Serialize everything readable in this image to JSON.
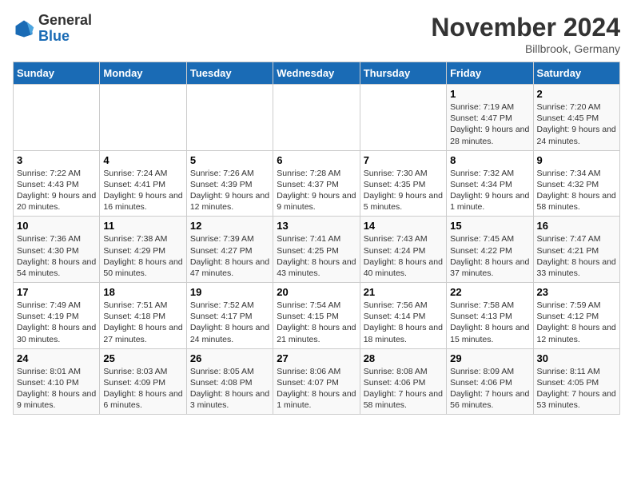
{
  "header": {
    "month_title": "November 2024",
    "location": "Billbrook, Germany",
    "logo_general": "General",
    "logo_blue": "Blue"
  },
  "days_of_week": [
    "Sunday",
    "Monday",
    "Tuesday",
    "Wednesday",
    "Thursday",
    "Friday",
    "Saturday"
  ],
  "weeks": [
    [
      {
        "day": "",
        "info": ""
      },
      {
        "day": "",
        "info": ""
      },
      {
        "day": "",
        "info": ""
      },
      {
        "day": "",
        "info": ""
      },
      {
        "day": "",
        "info": ""
      },
      {
        "day": "1",
        "info": "Sunrise: 7:19 AM\nSunset: 4:47 PM\nDaylight: 9 hours and 28 minutes."
      },
      {
        "day": "2",
        "info": "Sunrise: 7:20 AM\nSunset: 4:45 PM\nDaylight: 9 hours and 24 minutes."
      }
    ],
    [
      {
        "day": "3",
        "info": "Sunrise: 7:22 AM\nSunset: 4:43 PM\nDaylight: 9 hours and 20 minutes."
      },
      {
        "day": "4",
        "info": "Sunrise: 7:24 AM\nSunset: 4:41 PM\nDaylight: 9 hours and 16 minutes."
      },
      {
        "day": "5",
        "info": "Sunrise: 7:26 AM\nSunset: 4:39 PM\nDaylight: 9 hours and 12 minutes."
      },
      {
        "day": "6",
        "info": "Sunrise: 7:28 AM\nSunset: 4:37 PM\nDaylight: 9 hours and 9 minutes."
      },
      {
        "day": "7",
        "info": "Sunrise: 7:30 AM\nSunset: 4:35 PM\nDaylight: 9 hours and 5 minutes."
      },
      {
        "day": "8",
        "info": "Sunrise: 7:32 AM\nSunset: 4:34 PM\nDaylight: 9 hours and 1 minute."
      },
      {
        "day": "9",
        "info": "Sunrise: 7:34 AM\nSunset: 4:32 PM\nDaylight: 8 hours and 58 minutes."
      }
    ],
    [
      {
        "day": "10",
        "info": "Sunrise: 7:36 AM\nSunset: 4:30 PM\nDaylight: 8 hours and 54 minutes."
      },
      {
        "day": "11",
        "info": "Sunrise: 7:38 AM\nSunset: 4:29 PM\nDaylight: 8 hours and 50 minutes."
      },
      {
        "day": "12",
        "info": "Sunrise: 7:39 AM\nSunset: 4:27 PM\nDaylight: 8 hours and 47 minutes."
      },
      {
        "day": "13",
        "info": "Sunrise: 7:41 AM\nSunset: 4:25 PM\nDaylight: 8 hours and 43 minutes."
      },
      {
        "day": "14",
        "info": "Sunrise: 7:43 AM\nSunset: 4:24 PM\nDaylight: 8 hours and 40 minutes."
      },
      {
        "day": "15",
        "info": "Sunrise: 7:45 AM\nSunset: 4:22 PM\nDaylight: 8 hours and 37 minutes."
      },
      {
        "day": "16",
        "info": "Sunrise: 7:47 AM\nSunset: 4:21 PM\nDaylight: 8 hours and 33 minutes."
      }
    ],
    [
      {
        "day": "17",
        "info": "Sunrise: 7:49 AM\nSunset: 4:19 PM\nDaylight: 8 hours and 30 minutes."
      },
      {
        "day": "18",
        "info": "Sunrise: 7:51 AM\nSunset: 4:18 PM\nDaylight: 8 hours and 27 minutes."
      },
      {
        "day": "19",
        "info": "Sunrise: 7:52 AM\nSunset: 4:17 PM\nDaylight: 8 hours and 24 minutes."
      },
      {
        "day": "20",
        "info": "Sunrise: 7:54 AM\nSunset: 4:15 PM\nDaylight: 8 hours and 21 minutes."
      },
      {
        "day": "21",
        "info": "Sunrise: 7:56 AM\nSunset: 4:14 PM\nDaylight: 8 hours and 18 minutes."
      },
      {
        "day": "22",
        "info": "Sunrise: 7:58 AM\nSunset: 4:13 PM\nDaylight: 8 hours and 15 minutes."
      },
      {
        "day": "23",
        "info": "Sunrise: 7:59 AM\nSunset: 4:12 PM\nDaylight: 8 hours and 12 minutes."
      }
    ],
    [
      {
        "day": "24",
        "info": "Sunrise: 8:01 AM\nSunset: 4:10 PM\nDaylight: 8 hours and 9 minutes."
      },
      {
        "day": "25",
        "info": "Sunrise: 8:03 AM\nSunset: 4:09 PM\nDaylight: 8 hours and 6 minutes."
      },
      {
        "day": "26",
        "info": "Sunrise: 8:05 AM\nSunset: 4:08 PM\nDaylight: 8 hours and 3 minutes."
      },
      {
        "day": "27",
        "info": "Sunrise: 8:06 AM\nSunset: 4:07 PM\nDaylight: 8 hours and 1 minute."
      },
      {
        "day": "28",
        "info": "Sunrise: 8:08 AM\nSunset: 4:06 PM\nDaylight: 7 hours and 58 minutes."
      },
      {
        "day": "29",
        "info": "Sunrise: 8:09 AM\nSunset: 4:06 PM\nDaylight: 7 hours and 56 minutes."
      },
      {
        "day": "30",
        "info": "Sunrise: 8:11 AM\nSunset: 4:05 PM\nDaylight: 7 hours and 53 minutes."
      }
    ]
  ]
}
